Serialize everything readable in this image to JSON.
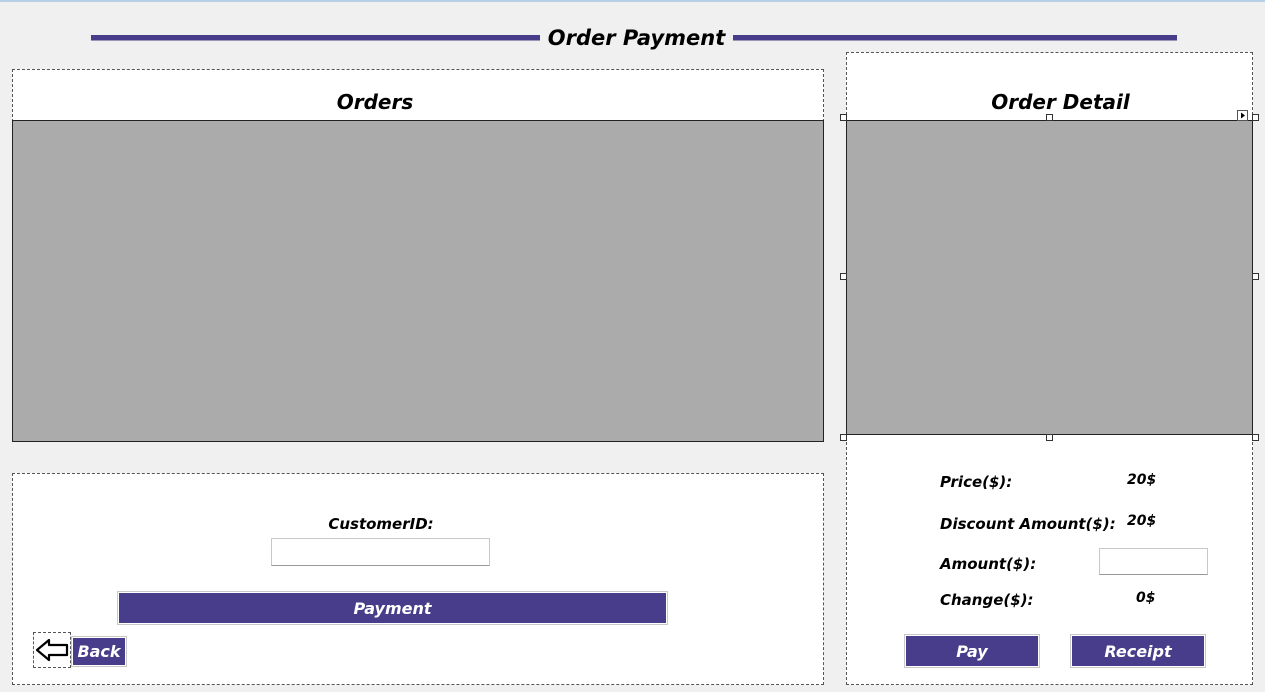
{
  "form": {
    "title": "Order Payment"
  },
  "orders": {
    "title": "Orders"
  },
  "order_detail": {
    "title": "Order Detail",
    "price_label": "Price($):",
    "price_value": "20$",
    "discount_label": "Discount Amount($):",
    "discount_value": "20$",
    "amount_label": "Amount($):",
    "amount_value": "",
    "change_label": "Change($):",
    "change_value": "0$",
    "pay_label": "Pay",
    "receipt_label": "Receipt"
  },
  "customer": {
    "id_label": "CustomerID:",
    "id_value": "",
    "payment_label": "Payment",
    "back_label": "Back"
  },
  "colors": {
    "accent": "#483d8b",
    "grid": "#ababab",
    "background": "#f0f0f0"
  },
  "icons": {
    "back": "arrow-left-icon",
    "smart_tag": "smart-tag-icon"
  }
}
